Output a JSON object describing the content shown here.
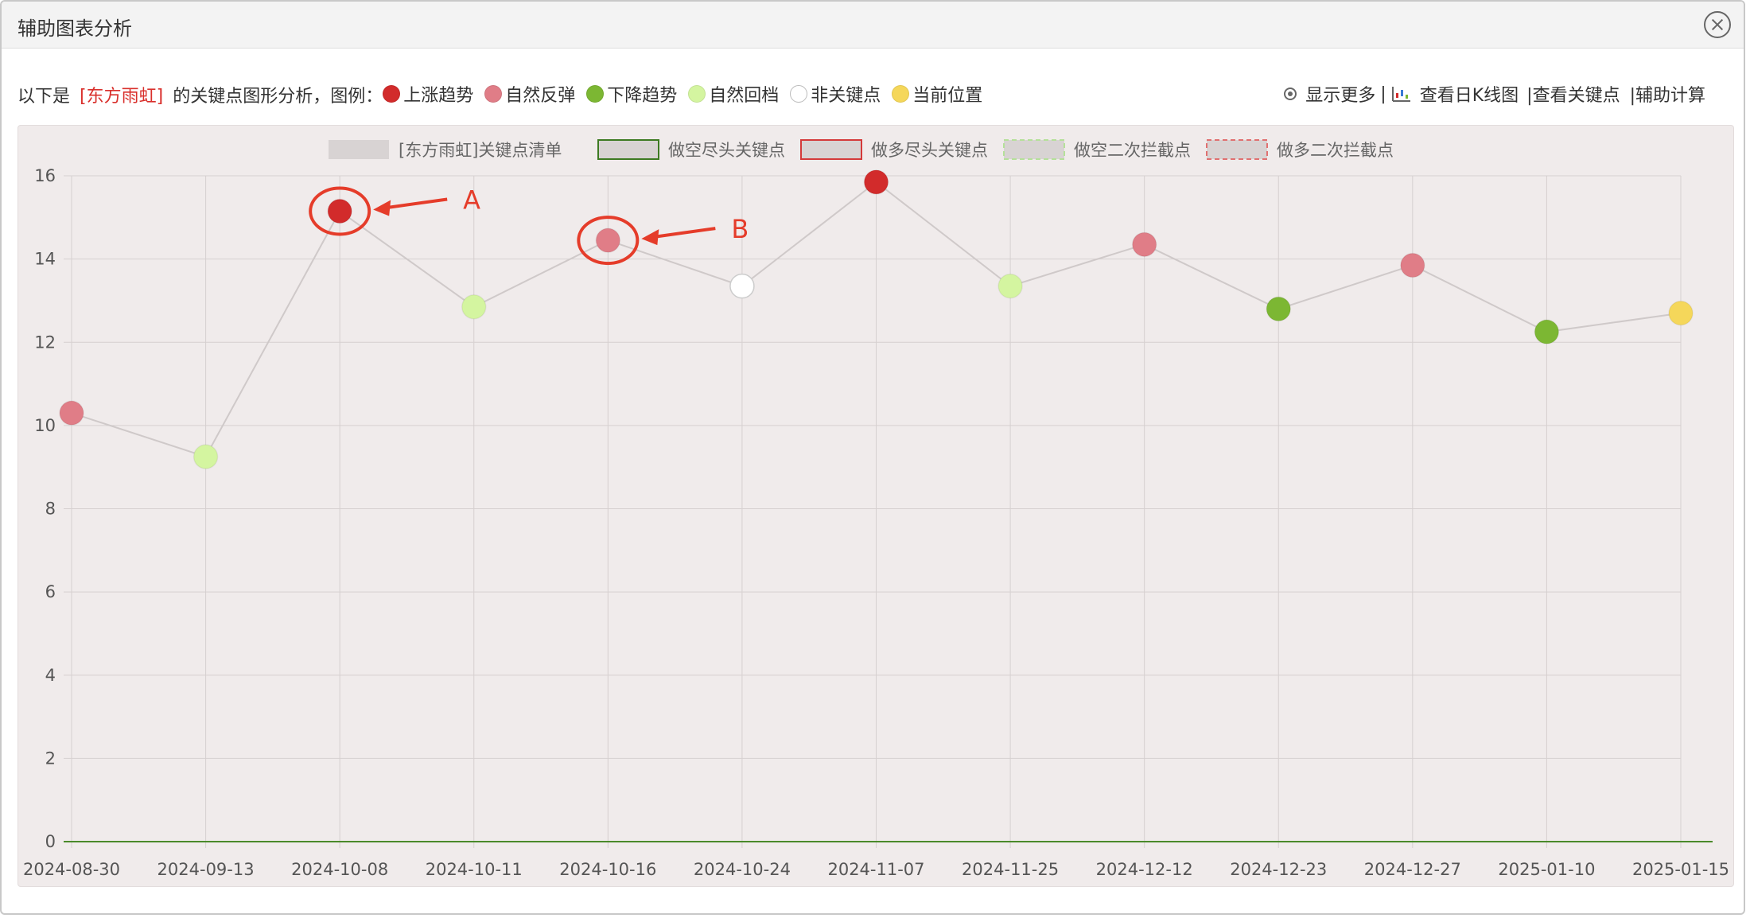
{
  "window": {
    "title": "辅助图表分析"
  },
  "info": {
    "prefix": "以下是",
    "stock": "[东方雨虹]",
    "suffix": "的关键点图形分析，图例：",
    "legend": [
      {
        "label": "上涨趋势",
        "color": "#d22b2b"
      },
      {
        "label": "自然反弹",
        "color": "#e07d87"
      },
      {
        "label": "下降趋势",
        "color": "#7cb733"
      },
      {
        "label": "自然回档",
        "color": "#d4f5a0"
      },
      {
        "label": "非关键点",
        "color": "#ffffff"
      },
      {
        "label": "当前位置",
        "color": "#f5d75a"
      }
    ]
  },
  "actions": {
    "show_more": "显示更多",
    "kline": "查看日K线图",
    "keypoints": "|查看关键点",
    "calc": "|辅助计算"
  },
  "chart_data": {
    "type": "line",
    "legend_placement": "top-center",
    "legend": [
      {
        "label": "[东方雨虹]关键点清单",
        "style": "fill-gray"
      },
      {
        "label": "做空尽头关键点",
        "style": "green-border"
      },
      {
        "label": "做多尽头关键点",
        "style": "red-border"
      },
      {
        "label": "做空二次拦截点",
        "style": "green-dashed"
      },
      {
        "label": "做多二次拦截点",
        "style": "red-dashed"
      }
    ],
    "categories": [
      "2024-08-30",
      "2024-09-13",
      "2024-10-08",
      "2024-10-11",
      "2024-10-16",
      "2024-10-24",
      "2024-11-07",
      "2024-11-25",
      "2024-12-12",
      "2024-12-23",
      "2024-12-27",
      "2025-01-10",
      "2025-01-15"
    ],
    "values": [
      10.3,
      9.25,
      15.15,
      12.85,
      14.45,
      13.35,
      15.85,
      13.35,
      14.35,
      12.8,
      13.85,
      12.25,
      12.7
    ],
    "point_types": [
      "自然反弹",
      "自然回档",
      "上涨趋势",
      "自然回档",
      "自然反弹",
      "非关键点",
      "上涨趋势",
      "自然回档",
      "自然反弹",
      "下降趋势",
      "自然反弹",
      "下降趋势",
      "当前位置"
    ],
    "ylim": [
      0,
      16
    ],
    "yticks": [
      0,
      2,
      4,
      6,
      8,
      10,
      12,
      14,
      16
    ],
    "grid": true,
    "annotations": [
      {
        "label": "A",
        "index": 2
      },
      {
        "label": "B",
        "index": 4
      }
    ]
  }
}
